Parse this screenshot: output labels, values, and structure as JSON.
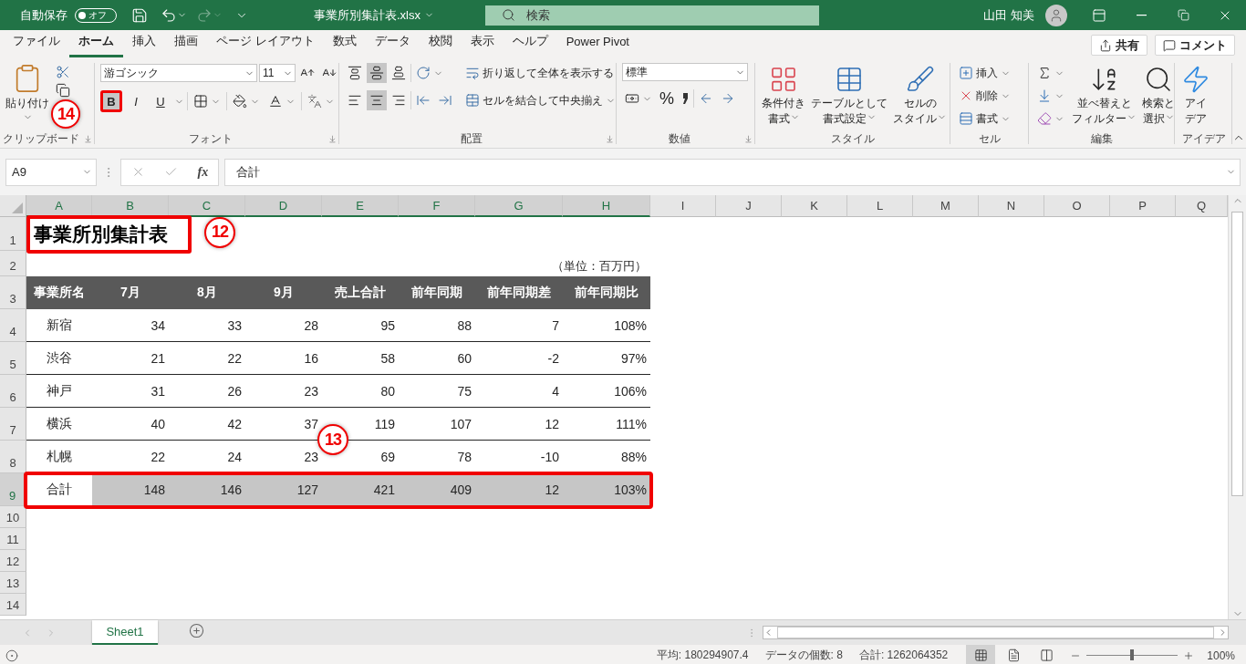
{
  "title_bar": {
    "autosave_label": "自動保存",
    "autosave": {
      "on": false,
      "label": "オフ"
    },
    "redo_disabled": true,
    "filename": "事業所別集計表.xlsx",
    "search_placeholder": "検索",
    "user_name": "山田 知美"
  },
  "menu_tabs": [
    {
      "label": "ファイル",
      "selected": false
    },
    {
      "label": "ホーム",
      "selected": true
    },
    {
      "label": "挿入",
      "selected": false
    },
    {
      "label": "描画",
      "selected": false
    },
    {
      "label": "ページ レイアウト",
      "selected": false
    },
    {
      "label": "数式",
      "selected": false
    },
    {
      "label": "データ",
      "selected": false
    },
    {
      "label": "校閲",
      "selected": false
    },
    {
      "label": "表示",
      "selected": false
    },
    {
      "label": "ヘルプ",
      "selected": false
    },
    {
      "label": "Power Pivot",
      "selected": false
    }
  ],
  "share_button": "共有",
  "comment_button": "コメント",
  "ribbon": {
    "groups": [
      {
        "kind": "clipboard",
        "label": "クリップボード",
        "launcher": true,
        "paste": "貼り付け",
        "callout": "14"
      },
      {
        "kind": "font",
        "label": "フォント",
        "launcher": true,
        "font_name": "游ゴシック",
        "font_size": "11",
        "bold": "B",
        "bold_highlighted": true,
        "italic": "I",
        "underline": "U"
      },
      {
        "kind": "alignment",
        "label": "配置",
        "launcher": true,
        "vertical_align": [
          {
            "selected": false
          },
          {
            "selected": true
          },
          {
            "selected": false
          }
        ],
        "horizontal_align": [
          {
            "selected": false
          },
          {
            "selected": true
          },
          {
            "selected": false
          }
        ],
        "wrap": "折り返して全体を表示する",
        "merge": "セルを結合して中央揃え"
      },
      {
        "kind": "number",
        "label": "数値",
        "launcher": true,
        "format": "標準",
        "percent": "%"
      },
      {
        "kind": "styles",
        "label": "スタイル",
        "launcher": false,
        "buttons": [
          [
            "条件付き",
            "書式"
          ],
          [
            "テーブルとして",
            "書式設定"
          ],
          [
            "セルの",
            "スタイル"
          ]
        ]
      },
      {
        "kind": "cells",
        "label": "セル",
        "launcher": false,
        "buttons": [
          "挿入",
          "削除",
          "書式"
        ]
      },
      {
        "kind": "editing",
        "label": "編集",
        "launcher": false,
        "buttons": [
          [
            "並べ替えと",
            "フィルター"
          ],
          [
            "検索と",
            "選択"
          ]
        ]
      },
      {
        "kind": "ideas",
        "label": "アイデア",
        "launcher": false,
        "buttons": [
          [
            "アイ",
            "デア"
          ]
        ]
      }
    ]
  },
  "formula_bar": {
    "name_box": "A9",
    "function_label": "fx",
    "formula": "合計"
  },
  "sheet": {
    "columns": [
      {
        "letter": "A",
        "selected": true
      },
      {
        "letter": "B",
        "selected": true
      },
      {
        "letter": "C",
        "selected": true
      },
      {
        "letter": "D",
        "selected": true
      },
      {
        "letter": "E",
        "selected": true
      },
      {
        "letter": "F",
        "selected": true
      },
      {
        "letter": "G",
        "selected": true
      },
      {
        "letter": "H",
        "selected": true
      },
      {
        "letter": "I",
        "selected": false
      },
      {
        "letter": "J",
        "selected": false
      },
      {
        "letter": "K",
        "selected": false
      },
      {
        "letter": "L",
        "selected": false
      },
      {
        "letter": "M",
        "selected": false
      },
      {
        "letter": "N",
        "selected": false
      },
      {
        "letter": "O",
        "selected": false
      },
      {
        "letter": "P",
        "selected": false
      },
      {
        "letter": "Q",
        "selected": false
      }
    ],
    "rows": [
      {
        "number": "1",
        "kind": "title",
        "selected": false,
        "highlighted": true,
        "callout": "12",
        "cells": [
          "事業所別集計表"
        ]
      },
      {
        "number": "2",
        "kind": "note",
        "selected": false,
        "highlighted": false,
        "cells": [
          "（単位：百万円）"
        ]
      },
      {
        "number": "3",
        "kind": "header",
        "selected": false,
        "highlighted": false,
        "cells": [
          "事業所名",
          "7月",
          "8月",
          "9月",
          "売上合計",
          "前年同期",
          "前年同期差",
          "前年同期比"
        ]
      },
      {
        "number": "4",
        "kind": "data",
        "selected": false,
        "highlighted": false,
        "cells": [
          "新宿",
          "34",
          "33",
          "28",
          "95",
          "88",
          "7",
          "108%"
        ]
      },
      {
        "number": "5",
        "kind": "data",
        "selected": false,
        "highlighted": false,
        "cells": [
          "渋谷",
          "21",
          "22",
          "16",
          "58",
          "60",
          "-2",
          "97%"
        ]
      },
      {
        "number": "6",
        "kind": "data",
        "selected": false,
        "highlighted": false,
        "cells": [
          "神戸",
          "31",
          "26",
          "23",
          "80",
          "75",
          "4",
          "106%"
        ]
      },
      {
        "number": "7",
        "kind": "data",
        "selected": false,
        "highlighted": false,
        "cells": [
          "横浜",
          "40",
          "42",
          "37",
          "119",
          "107",
          "12",
          "111%"
        ]
      },
      {
        "number": "8",
        "kind": "data",
        "selected": false,
        "highlighted": false,
        "cells": [
          "札幌",
          "22",
          "24",
          "23",
          "69",
          "78",
          "-10",
          "88%"
        ]
      },
      {
        "number": "9",
        "kind": "total",
        "selected": true,
        "highlighted": true,
        "callout": "13",
        "cells": [
          "合計",
          "148",
          "146",
          "127",
          "421",
          "409",
          "12",
          "103%"
        ]
      },
      {
        "number": "10",
        "kind": "empty",
        "selected": false,
        "highlighted": false
      },
      {
        "number": "11",
        "kind": "empty",
        "selected": false,
        "highlighted": false
      },
      {
        "number": "12",
        "kind": "empty",
        "selected": false,
        "highlighted": false
      },
      {
        "number": "13",
        "kind": "empty",
        "selected": false,
        "highlighted": false
      },
      {
        "number": "14",
        "kind": "empty",
        "selected": false,
        "highlighted": false
      }
    ]
  },
  "sheet_tabs": [
    {
      "label": "Sheet1",
      "selected": true
    }
  ],
  "status_bar": {
    "average": "平均: 180294907.4",
    "count": "データの個数: 8",
    "sum": "合計: 1262064352",
    "views": [
      {
        "kind": "normal",
        "selected": true
      },
      {
        "kind": "page_layout",
        "selected": false
      },
      {
        "kind": "page_break",
        "selected": false
      }
    ],
    "zoom": {
      "level": 0.5,
      "label": "100%"
    }
  }
}
